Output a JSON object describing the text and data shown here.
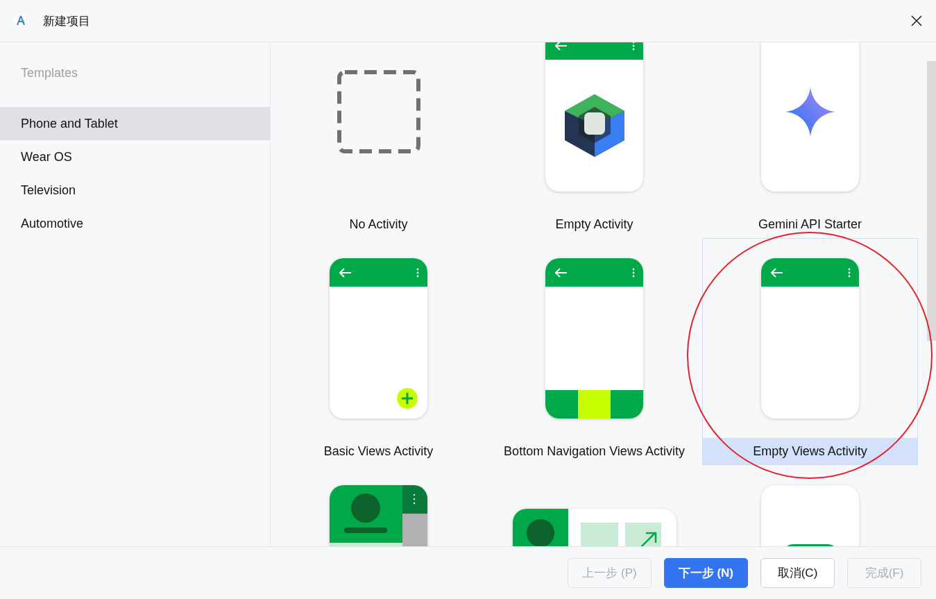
{
  "window": {
    "title": "新建项目"
  },
  "sidebar": {
    "header": "Templates",
    "items": [
      {
        "label": "Phone and Tablet",
        "selected": true
      },
      {
        "label": "Wear OS",
        "selected": false
      },
      {
        "label": "Television",
        "selected": false
      },
      {
        "label": "Automotive",
        "selected": false
      }
    ]
  },
  "templates": [
    {
      "name": "No Activity",
      "kind": "blank",
      "selected": false
    },
    {
      "name": "Empty Activity",
      "kind": "compose",
      "selected": false
    },
    {
      "name": "Gemini API Starter",
      "kind": "gemini",
      "selected": false
    },
    {
      "name": "Basic Views Activity",
      "kind": "basic",
      "selected": false
    },
    {
      "name": "Bottom Navigation Views Activity",
      "kind": "bottomnav",
      "selected": false
    },
    {
      "name": "Empty Views Activity",
      "kind": "views",
      "selected": true
    },
    {
      "kind": "profile",
      "selected": false
    },
    {
      "kind": "tablet",
      "selected": false
    },
    {
      "kind": "partial",
      "selected": false
    }
  ],
  "buttons": [
    {
      "label": "上一步 (P)",
      "kind": "secondary",
      "disabled": true
    },
    {
      "label": "下一步 (N)",
      "kind": "primary",
      "disabled": false
    },
    {
      "label": "取消(C)",
      "kind": "secondary",
      "disabled": false
    },
    {
      "label": "完成(F)",
      "kind": "secondary",
      "disabled": true
    }
  ]
}
